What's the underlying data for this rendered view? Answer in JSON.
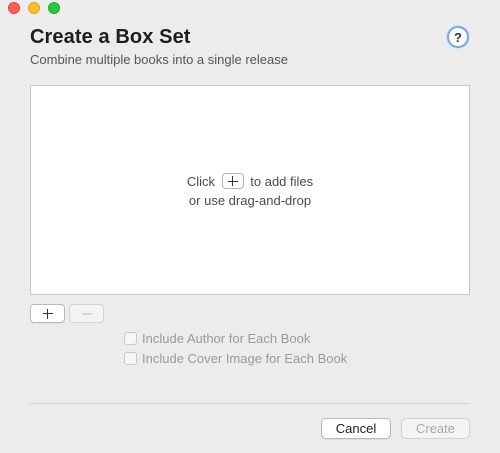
{
  "window": {
    "controls": {
      "close": "close-icon",
      "minimize": "minimize-icon",
      "zoom": "zoom-icon",
      "close_color": "#fe5f57",
      "minimize_color": "#febc2e",
      "zoom_color": "#28c840"
    }
  },
  "header": {
    "title": "Create a Box Set",
    "subtitle": "Combine multiple books into a single release",
    "help_label": "?"
  },
  "dropzone": {
    "hint_prefix": "Click",
    "hint_suffix": "to add files",
    "hint_line2": "or use drag-and-drop",
    "inline_icon": "plus-icon"
  },
  "list_controls": {
    "add_icon": "plus-icon",
    "remove_icon": "minus-icon"
  },
  "options": [
    {
      "label": "Include Author for Each Book",
      "checked": false,
      "enabled": false
    },
    {
      "label": "Include Cover Image for Each Book",
      "checked": false,
      "enabled": false
    }
  ],
  "footer": {
    "cancel_label": "Cancel",
    "create_label": "Create",
    "create_enabled": false
  },
  "colors": {
    "window_bg": "#ececec",
    "help_ring": "#7aa7e8"
  }
}
